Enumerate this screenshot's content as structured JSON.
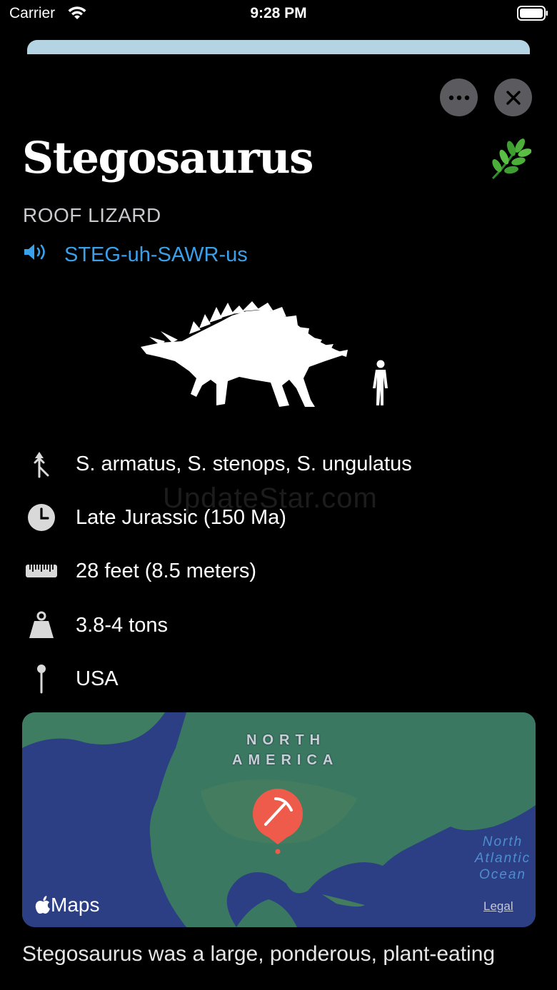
{
  "status_bar": {
    "carrier": "Carrier",
    "time": "9:28 PM"
  },
  "header": {
    "title": "Stegosaurus",
    "meaning": "ROOF LIZARD",
    "pronunciation": "STEG-uh-SAWR-us",
    "diet_icon": "leaf-icon"
  },
  "facts": [
    {
      "icon": "evolution-branch-icon",
      "text": "S. armatus, S. stenops, S. ungulatus"
    },
    {
      "icon": "clock-icon",
      "text": "Late Jurassic (150 Ma)"
    },
    {
      "icon": "ruler-icon",
      "text": "28 feet (8.5 meters)"
    },
    {
      "icon": "weight-icon",
      "text": "3.8-4 tons"
    },
    {
      "icon": "location-pin-icon",
      "text": "USA"
    }
  ],
  "watermark": "UpdateStar.com",
  "map": {
    "continent_line1": "NORTH",
    "continent_line2": "AMERICA",
    "ocean_line1": "North",
    "ocean_line2": "Atlantic",
    "ocean_line3": "Ocean",
    "maps_brand": "Maps",
    "legal": "Legal"
  },
  "description": "Stegosaurus was a large, ponderous, plant-eating",
  "colors": {
    "accent": "#3aa0ea",
    "pin": "#ef5b4b",
    "button_bg": "#5b5b5f"
  }
}
